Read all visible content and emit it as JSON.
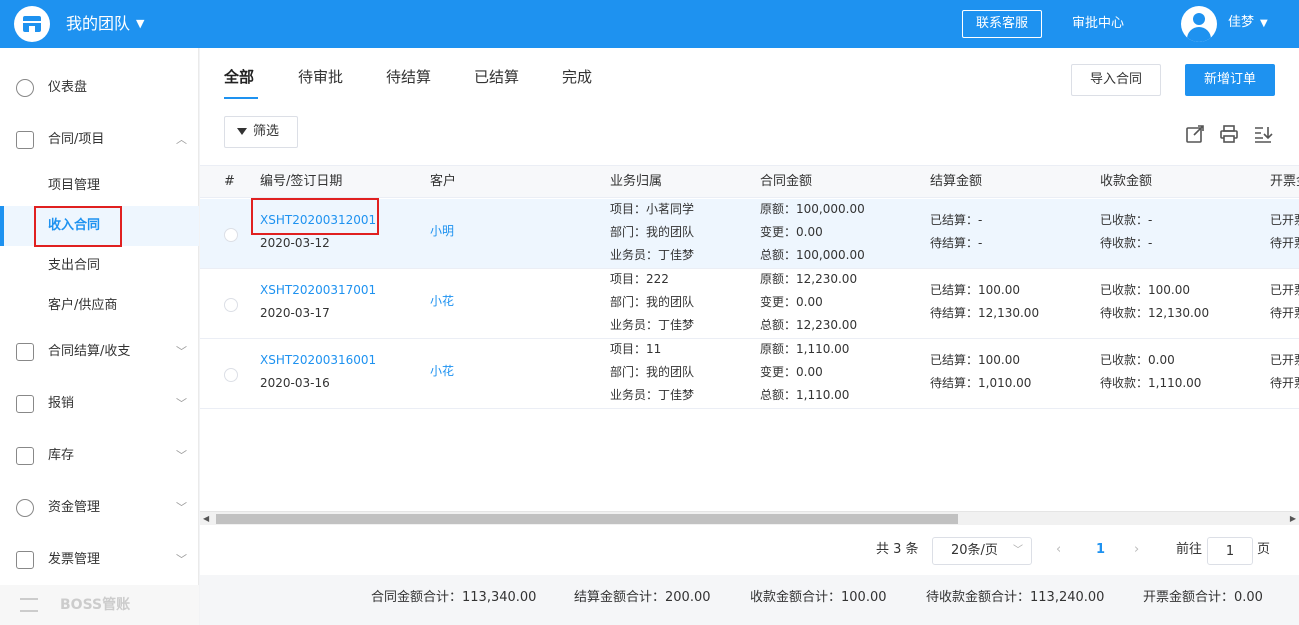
{
  "header": {
    "team_name": "我的团队",
    "support_label": "联系客服",
    "approval_label": "审批中心",
    "user_name": "佳梦"
  },
  "sidebar": {
    "items": [
      {
        "label": "仪表盘"
      },
      {
        "label": "合同/项目"
      },
      {
        "label": "合同结算/收支"
      },
      {
        "label": "报销"
      },
      {
        "label": "库存"
      },
      {
        "label": "资金管理"
      },
      {
        "label": "发票管理"
      }
    ],
    "sub_items": [
      {
        "label": "项目管理"
      },
      {
        "label": "收入合同"
      },
      {
        "label": "支出合同"
      },
      {
        "label": "客户/供应商"
      }
    ],
    "boss_label": "BOSS管账"
  },
  "tabs": [
    {
      "label": "全部"
    },
    {
      "label": "待审批"
    },
    {
      "label": "待结算"
    },
    {
      "label": "已结算"
    },
    {
      "label": "完成"
    }
  ],
  "toolbar": {
    "import_label": "导入合同",
    "new_label": "新增订单",
    "filter_label": "筛选"
  },
  "table": {
    "columns": [
      "#",
      "编号/签订日期",
      "客户",
      "业务归属",
      "合同金额",
      "结算金额",
      "收款金额",
      "开票金额"
    ],
    "rows": [
      {
        "code": "XSHT20200312001",
        "date": "2020-03-12",
        "customer": "小明",
        "project": "项目：小茗同学",
        "dept": "部门：我的团队",
        "staff": "业务员：丁佳梦",
        "orig": "原额：100,000.00",
        "change": "变更：0.00",
        "total": "总额：100,000.00",
        "settled": "已结算：-",
        "to_settle": "待结算：-",
        "received": "已收款：-",
        "to_receive": "待收款：-",
        "invoiced": "已开票",
        "to_invoice": "待开票"
      },
      {
        "code": "XSHT20200317001",
        "date": "2020-03-17",
        "customer": "小花",
        "project": "项目：222",
        "dept": "部门：我的团队",
        "staff": "业务员：丁佳梦",
        "orig": "原额：12,230.00",
        "change": "变更：0.00",
        "total": "总额：12,230.00",
        "settled": "已结算：100.00",
        "to_settle": "待结算：12,130.00",
        "received": "已收款：100.00",
        "to_receive": "待收款：12,130.00",
        "invoiced": "已开票",
        "to_invoice": "待开票"
      },
      {
        "code": "XSHT20200316001",
        "date": "2020-03-16",
        "customer": "小花",
        "project": "项目：11",
        "dept": "部门：我的团队",
        "staff": "业务员：丁佳梦",
        "orig": "原额：1,110.00",
        "change": "变更：0.00",
        "total": "总额：1,110.00",
        "settled": "已结算：100.00",
        "to_settle": "待结算：1,010.00",
        "received": "已收款：0.00",
        "to_receive": "待收款：1,110.00",
        "invoiced": "已开票",
        "to_invoice": "待开票"
      }
    ]
  },
  "pagination": {
    "total": "共 3 条",
    "page_size": "20条/页",
    "current_page": "1",
    "goto_label": "前往",
    "goto_value": "1",
    "page_unit": "页"
  },
  "summary": {
    "contract_total": "合同金额合计：113,340.00",
    "settle_total": "结算金额合计：200.00",
    "received_total": "收款金额合计：100.00",
    "pending_total": "待收款金额合计：113,240.00",
    "invoice_total": "开票金额合计：0.00"
  },
  "colors": {
    "primary": "#1e92f0",
    "highlight": "#e02020"
  }
}
